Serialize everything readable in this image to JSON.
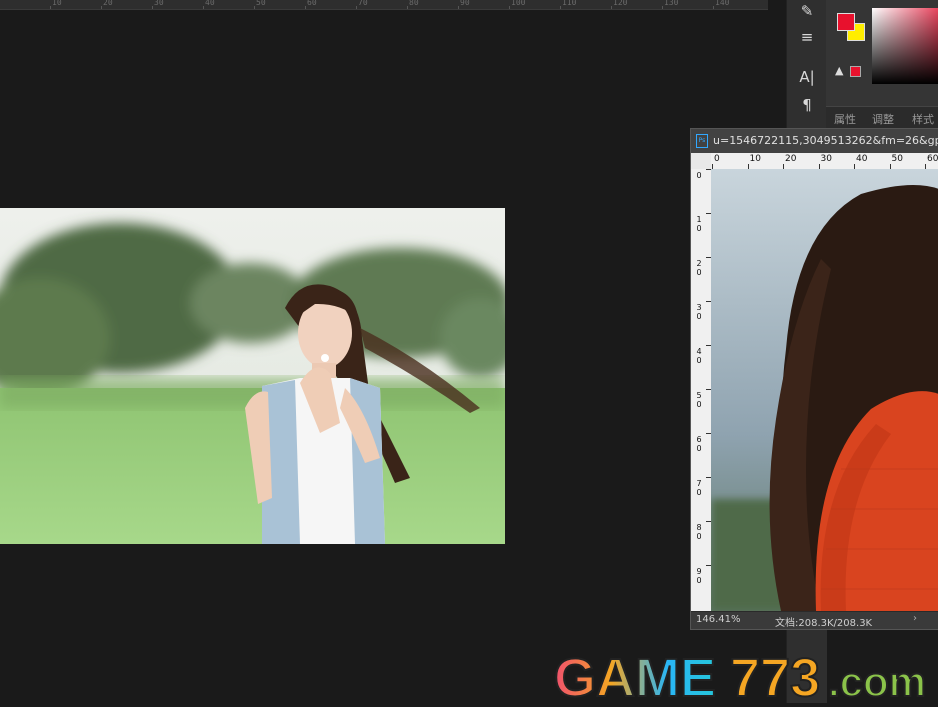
{
  "canvas": {
    "top_ruler_labels": [
      "10",
      "20",
      "30",
      "40",
      "50",
      "60",
      "70",
      "80",
      "90",
      "100",
      "110",
      "120",
      "130",
      "140"
    ]
  },
  "tools": [
    {
      "name": "brush-icon",
      "glyph": "✎"
    },
    {
      "name": "adjustment-sliders-icon",
      "glyph": "≡"
    },
    {
      "name": "character-icon",
      "glyph": "A|"
    },
    {
      "name": "paragraph-icon",
      "glyph": "¶"
    }
  ],
  "colors": {
    "foreground": "#e8112d",
    "background": "#ffee00",
    "ps_blue": "#31a8ff"
  },
  "panel_tabs": [
    "属性",
    "调整",
    "样式"
  ],
  "document": {
    "title": "u=1546722115,3049513262&fm=26&gp",
    "app_icon_text": "Ps",
    "hruler_labels": [
      "0",
      "10",
      "20",
      "30",
      "40",
      "50",
      "60"
    ],
    "vruler_labels": [
      "0",
      "1\n0",
      "2\n0",
      "3\n0",
      "4\n0",
      "5\n0",
      "6\n0",
      "7\n0",
      "8\n0",
      "9\n0"
    ],
    "zoom": "146.41%",
    "doc_size": "文档:208.3K/208.3K",
    "status_arrow": "›"
  },
  "watermark": {
    "text_game": "GAME",
    "text_num": "773",
    "text_domain": ".com"
  }
}
